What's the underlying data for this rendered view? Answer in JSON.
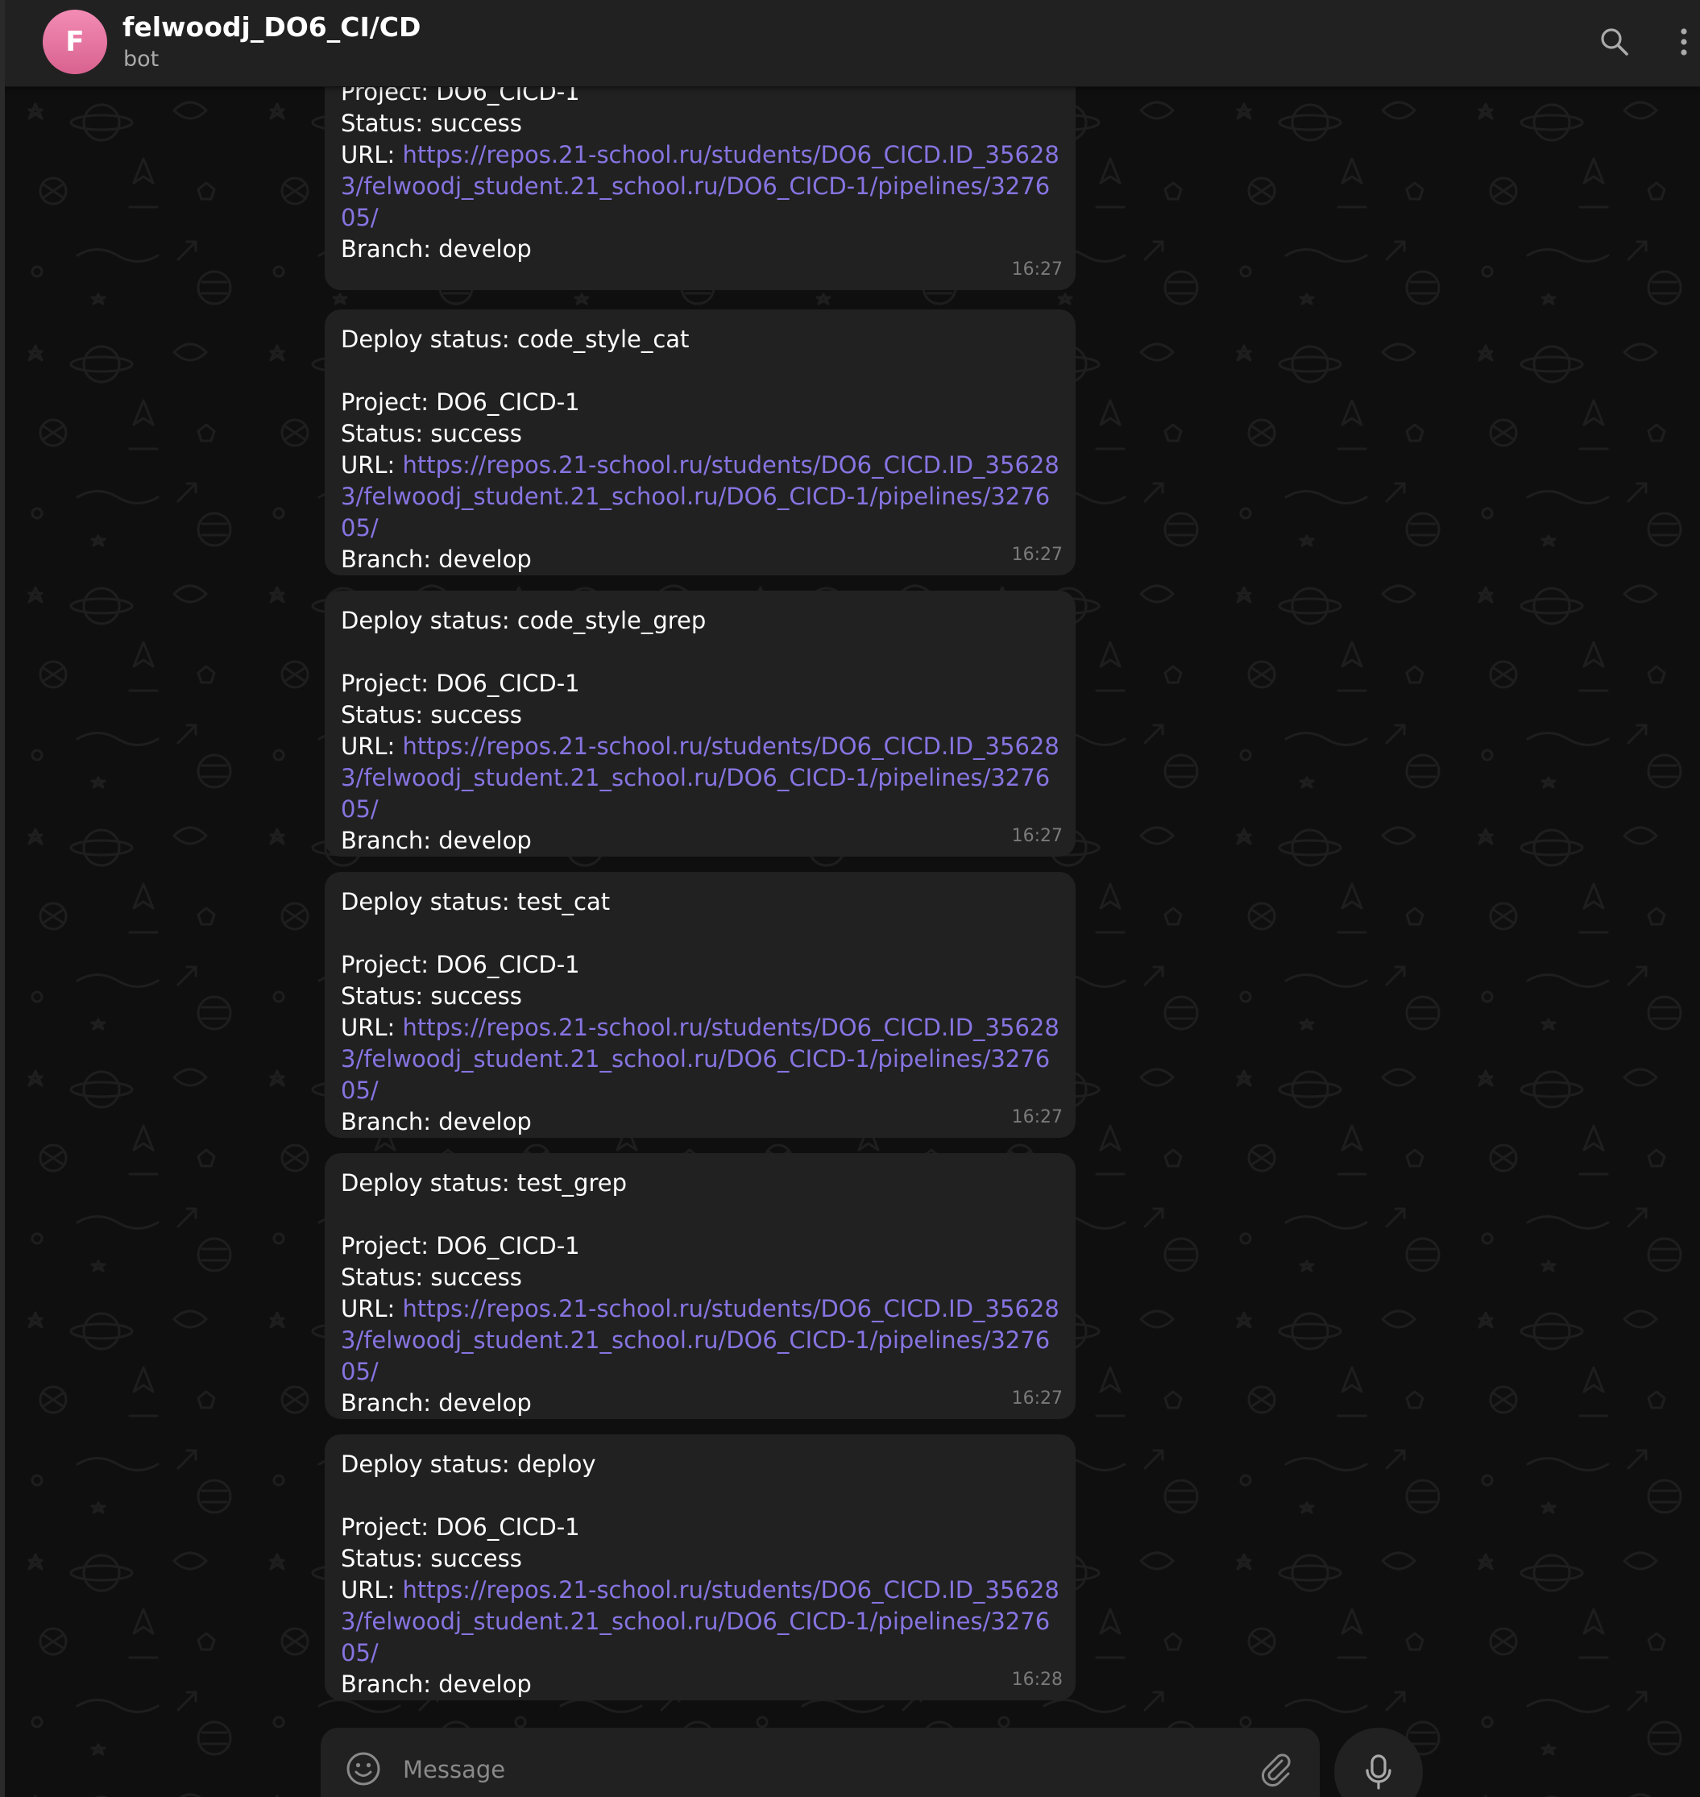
{
  "header": {
    "avatar_letter": "F",
    "title": "felwoodj_DO6_CI/CD",
    "subtitle": "bot",
    "search_icon": "search-icon",
    "more_icon": "more-vertical-icon"
  },
  "colors": {
    "background": "#0f0f0f",
    "header": "#212121",
    "bubble": "#212121",
    "link": "#8774e1",
    "avatar_gradient_top": "#f28cb5",
    "avatar_gradient_bottom": "#d9628f"
  },
  "messages": [
    {
      "project": "Project: DO6_CICD-1",
      "status": "Status: success",
      "url_label": "URL: ",
      "url": "https://repos.21-school.ru/students/DO6_CICD.ID_356283/felwoodj_student.21_school.ru/DO6_CICD-1/pipelines/327605/",
      "branch": "Branch: develop",
      "time": "16:27"
    },
    {
      "deploy_status": "Deploy status: code_style_cat",
      "project": "Project: DO6_CICD-1",
      "status": "Status: success",
      "url_label": "URL: ",
      "url": "https://repos.21-school.ru/students/DO6_CICD.ID_356283/felwoodj_student.21_school.ru/DO6_CICD-1/pipelines/327605/",
      "branch": "Branch: develop",
      "time": "16:27"
    },
    {
      "deploy_status": "Deploy status: code_style_grep",
      "project": "Project: DO6_CICD-1",
      "status": "Status: success",
      "url_label": "URL: ",
      "url": "https://repos.21-school.ru/students/DO6_CICD.ID_356283/felwoodj_student.21_school.ru/DO6_CICD-1/pipelines/327605/",
      "branch": "Branch: develop",
      "time": "16:27"
    },
    {
      "deploy_status": "Deploy status: test_cat",
      "project": "Project: DO6_CICD-1",
      "status": "Status: success",
      "url_label": "URL: ",
      "url": "https://repos.21-school.ru/students/DO6_CICD.ID_356283/felwoodj_student.21_school.ru/DO6_CICD-1/pipelines/327605/",
      "branch": "Branch: develop",
      "time": "16:27"
    },
    {
      "deploy_status": "Deploy status: test_grep",
      "project": "Project: DO6_CICD-1",
      "status": "Status: success",
      "url_label": "URL: ",
      "url": "https://repos.21-school.ru/students/DO6_CICD.ID_356283/felwoodj_student.21_school.ru/DO6_CICD-1/pipelines/327605/",
      "branch": "Branch: develop",
      "time": "16:27"
    },
    {
      "deploy_status": "Deploy status: deploy",
      "project": "Project: DO6_CICD-1",
      "status": "Status: success",
      "url_label": "URL: ",
      "url": "https://repos.21-school.ru/students/DO6_CICD.ID_356283/felwoodj_student.21_school.ru/DO6_CICD-1/pipelines/327605/",
      "branch": "Branch: develop",
      "time": "16:28"
    }
  ],
  "composer": {
    "placeholder": "Message",
    "emoji_icon": "emoji-icon",
    "attach_icon": "paperclip-icon",
    "mic_icon": "microphone-icon"
  }
}
